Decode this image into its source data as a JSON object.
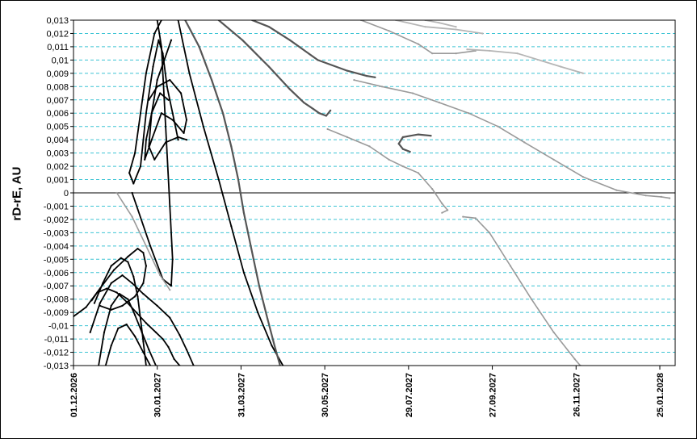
{
  "chart_data": {
    "type": "scatter",
    "title": "",
    "xlabel": "",
    "ylabel": "rD-rE, AU",
    "x_tick_labels": [
      "01.12.2026",
      "30.01.2027",
      "31.03.2027",
      "30.05.2027",
      "29.07.2027",
      "27.09.2027",
      "26.11.2027",
      "25.01.2028"
    ],
    "xlim": [
      "01.12.2026",
      "05.02.2028"
    ],
    "ylim": [
      -0.013,
      0.013
    ],
    "y_tick_labels": [
      "0,013",
      "0,012",
      "0,011",
      "0,01",
      "0,009",
      "0,008",
      "0,007",
      "0,006",
      "0,005",
      "0,004",
      "0,003",
      "0,002",
      "0,001",
      "0",
      "-0,001",
      "-0,002",
      "-0,003",
      "-0,004",
      "-0,005",
      "-0,006",
      "-0,007",
      "-0,008",
      "-0,009",
      "-0,01",
      "-0,011",
      "-0,012",
      "-0,013"
    ],
    "grid": "horizontal dashed",
    "zero_line": true,
    "legend": "none",
    "colors": {
      "grid": "#3cc4d4",
      "dark": "#000000",
      "mid": "#555555",
      "light": "#9a9a9a",
      "lighter": "#b5b5b5"
    },
    "series": [
      {
        "color": "dark",
        "points": [
          [
            "30.01.2027",
            0.013
          ],
          [
            "02.02.2027",
            0.011
          ],
          [
            "05.02.2027",
            0.005
          ],
          [
            "08.02.2027",
            -0.001
          ],
          [
            "10.02.2027",
            -0.005
          ],
          [
            "09.02.2027",
            -0.007
          ],
          [
            "03.02.2027",
            -0.0065
          ],
          [
            "25.01.2027",
            -0.004
          ],
          [
            "12.01.2027",
            0.0
          ]
        ]
      },
      {
        "color": "dark",
        "points": [
          [
            "02.02.2027",
            0.013
          ],
          [
            "28.01.2027",
            0.012
          ],
          [
            "22.01.2027",
            0.009
          ],
          [
            "18.01.2027",
            0.006
          ],
          [
            "14.01.2027",
            0.003
          ],
          [
            "10.01.2027",
            0.0015
          ],
          [
            "13.01.2027",
            0.0007
          ],
          [
            "18.01.2027",
            0.002
          ],
          [
            "22.01.2027",
            0.006
          ],
          [
            "27.01.2027",
            0.0095
          ],
          [
            "31.01.2027",
            0.0115
          ],
          [
            "03.02.2027",
            0.0105
          ],
          [
            "06.02.2027",
            0.008
          ],
          [
            "10.02.2027",
            0.006
          ],
          [
            "14.02.2027",
            0.004
          ]
        ]
      },
      {
        "color": "dark",
        "points": [
          [
            "07.02.2027",
            0.007
          ],
          [
            "01.02.2027",
            0.0075
          ],
          [
            "26.01.2027",
            0.006
          ],
          [
            "22.01.2027",
            0.004
          ],
          [
            "21.01.2027",
            0.0025
          ],
          [
            "26.01.2027",
            0.004
          ],
          [
            "02.02.2027",
            0.006
          ],
          [
            "10.02.2027",
            0.0055
          ],
          [
            "18.02.2027",
            0.0045
          ],
          [
            "20.02.2027",
            0.0055
          ],
          [
            "16.02.2027",
            0.0075
          ],
          [
            "08.02.2027",
            0.0085
          ],
          [
            "30.01.2027",
            0.008
          ],
          [
            "24.01.2027",
            0.007
          ]
        ]
      },
      {
        "color": "dark",
        "points": [
          [
            "09.02.2027",
            0.0115
          ],
          [
            "04.02.2027",
            0.01
          ],
          [
            "30.01.2027",
            0.0085
          ],
          [
            "26.01.2027",
            0.006
          ],
          [
            "24.01.2027",
            0.0035
          ],
          [
            "28.01.2027",
            0.0025
          ],
          [
            "05.02.2027",
            0.0038
          ],
          [
            "14.02.2027",
            0.0042
          ],
          [
            "20.02.2027",
            0.004
          ]
        ]
      },
      {
        "color": "dark",
        "points": [
          [
            "14.02.2027",
            0.013
          ],
          [
            "22.02.2027",
            0.009
          ],
          [
            "04.03.2027",
            0.005
          ],
          [
            "15.03.2027",
            0.001
          ],
          [
            "24.03.2027",
            -0.0025
          ],
          [
            "02.04.2027",
            -0.006
          ],
          [
            "12.04.2027",
            -0.009
          ],
          [
            "22.04.2027",
            -0.0115
          ],
          [
            "30.04.2027",
            -0.013
          ]
        ]
      },
      {
        "color": "dark",
        "points": [
          [
            "01.12.2026",
            -0.0093
          ],
          [
            "10.12.2026",
            -0.0086
          ],
          [
            "20.12.2026",
            -0.0072
          ],
          [
            "30.12.2026",
            -0.0058
          ],
          [
            "09.01.2027",
            -0.0048
          ],
          [
            "16.01.2027",
            -0.0042
          ],
          [
            "20.01.2027",
            -0.0045
          ],
          [
            "22.01.2027",
            -0.0055
          ],
          [
            "20.01.2027",
            -0.0068
          ],
          [
            "14.01.2027",
            -0.0078
          ],
          [
            "05.01.2027",
            -0.0085
          ],
          [
            "28.12.2026",
            -0.0088
          ],
          [
            "20.12.2026",
            -0.0085
          ]
        ]
      },
      {
        "color": "dark",
        "points": [
          [
            "16.12.2026",
            -0.0083
          ],
          [
            "22.12.2026",
            -0.0068
          ],
          [
            "28.12.2026",
            -0.0055
          ],
          [
            "04.01.2027",
            -0.0049
          ],
          [
            "09.01.2027",
            -0.0052
          ],
          [
            "13.01.2027",
            -0.0063
          ],
          [
            "16.01.2027",
            -0.0078
          ],
          [
            "18.01.2027",
            -0.0095
          ],
          [
            "20.01.2027",
            -0.0112
          ],
          [
            "22.01.2027",
            -0.013
          ]
        ]
      },
      {
        "color": "dark",
        "points": [
          [
            "19.12.2026",
            -0.013
          ],
          [
            "23.12.2026",
            -0.0105
          ],
          [
            "28.12.2026",
            -0.0085
          ],
          [
            "03.01.2027",
            -0.0076
          ],
          [
            "09.01.2027",
            -0.008
          ],
          [
            "14.01.2027",
            -0.0092
          ],
          [
            "19.01.2027",
            -0.0105
          ],
          [
            "24.01.2027",
            -0.0118
          ],
          [
            "29.01.2027",
            -0.013
          ]
        ]
      },
      {
        "color": "dark",
        "points": [
          [
            "24.12.2026",
            -0.013
          ],
          [
            "28.12.2026",
            -0.0115
          ],
          [
            "02.01.2027",
            -0.0102
          ],
          [
            "08.01.2027",
            -0.0099
          ],
          [
            "14.01.2027",
            -0.0108
          ],
          [
            "20.01.2027",
            -0.012
          ],
          [
            "25.01.2027",
            -0.013
          ]
        ]
      },
      {
        "color": "dark",
        "points": [
          [
            "14.12.2026",
            -0.0081
          ],
          [
            "18.12.2026",
            -0.0075
          ],
          [
            "25.12.2026",
            -0.0072
          ],
          [
            "01.01.2027",
            -0.0075
          ],
          [
            "08.01.2027",
            -0.0082
          ],
          [
            "15.01.2027",
            -0.009
          ],
          [
            "22.01.2027",
            -0.0098
          ],
          [
            "29.01.2027",
            -0.0105
          ],
          [
            "03.02.2027",
            -0.011
          ],
          [
            "07.02.2027",
            -0.0116
          ],
          [
            "11.02.2027",
            -0.0125
          ],
          [
            "15.02.2027",
            -0.013
          ]
        ]
      },
      {
        "color": "dark",
        "points": [
          [
            "13.12.2026",
            -0.0105
          ],
          [
            "20.12.2026",
            -0.0083
          ],
          [
            "28.12.2026",
            -0.0068
          ],
          [
            "05.01.2027",
            -0.0062
          ],
          [
            "12.01.2027",
            -0.0068
          ],
          [
            "20.01.2027",
            -0.0076
          ],
          [
            "30.01.2027",
            -0.0085
          ],
          [
            "08.02.2027",
            -0.0094
          ],
          [
            "15.02.2027",
            -0.0107
          ],
          [
            "20.02.2027",
            -0.0118
          ],
          [
            "25.02.2027",
            -0.013
          ]
        ]
      },
      {
        "color": "mid",
        "points": [
          [
            "19.02.2027",
            0.013
          ],
          [
            "01.03.2027",
            0.011
          ],
          [
            "10.03.2027",
            0.0085
          ],
          [
            "18.03.2027",
            0.006
          ],
          [
            "24.03.2027",
            0.0035
          ],
          [
            "29.03.2027",
            0.001
          ],
          [
            "02.04.2027",
            -0.0015
          ],
          [
            "07.04.2027",
            -0.004
          ],
          [
            "13.04.2027",
            -0.007
          ],
          [
            "19.04.2027",
            -0.0095
          ],
          [
            "24.04.2027",
            -0.0115
          ],
          [
            "28.04.2027",
            -0.013
          ]
        ]
      },
      {
        "color": "mid",
        "points": [
          [
            "15.03.2027",
            0.013
          ],
          [
            "01.04.2027",
            0.0115
          ],
          [
            "20.04.2027",
            0.0095
          ],
          [
            "05.05.2027",
            0.0078
          ],
          [
            "15.05.2027",
            0.0068
          ],
          [
            "22.05.2027",
            0.0063
          ],
          [
            "26.05.2027",
            0.006
          ],
          [
            "31.05.2027",
            0.0058
          ],
          [
            "03.06.2027",
            0.0062
          ]
        ]
      },
      {
        "color": "mid",
        "points": [
          [
            "08.04.2027",
            0.013
          ],
          [
            "20.04.2027",
            0.0125
          ],
          [
            "05.05.2027",
            0.0115
          ],
          [
            "25.05.2027",
            0.01
          ],
          [
            "15.06.2027",
            0.0092
          ],
          [
            "29.06.2027",
            0.0088
          ],
          [
            "05.07.2027",
            0.0087
          ]
        ]
      },
      {
        "color": "mid",
        "points": [
          [
            "14.08.2027",
            0.0043
          ],
          [
            "05.08.2027",
            0.0044
          ],
          [
            "25.07.2027",
            0.0042
          ],
          [
            "22.07.2027",
            0.0037
          ],
          [
            "25.07.2027",
            0.0033
          ],
          [
            "30.07.2027",
            0.0031
          ]
        ]
      },
      {
        "color": "light",
        "points": [
          [
            "25.06.2027",
            0.013
          ],
          [
            "15.07.2027",
            0.0122
          ],
          [
            "05.08.2027",
            0.0112
          ],
          [
            "15.08.2027",
            0.0105
          ],
          [
            "01.09.2027",
            0.0105
          ],
          [
            "15.09.2027",
            0.0107
          ]
        ]
      },
      {
        "color": "light",
        "points": [
          [
            "20.06.2027",
            0.0085
          ],
          [
            "10.07.2027",
            0.008
          ],
          [
            "01.08.2027",
            0.0075
          ],
          [
            "20.08.2027",
            0.0068
          ],
          [
            "10.09.2027",
            0.006
          ],
          [
            "01.10.2027",
            0.005
          ],
          [
            "20.10.2027",
            0.0038
          ],
          [
            "10.11.2027",
            0.0025
          ],
          [
            "01.12.2027",
            0.0012
          ],
          [
            "25.12.2027",
            0.0002
          ],
          [
            "15.01.2028",
            -0.0002
          ],
          [
            "26.01.2028",
            -0.0003
          ],
          [
            "01.02.2028",
            -0.0004
          ]
        ]
      },
      {
        "color": "light",
        "points": [
          [
            "01.01.2027",
            0.0
          ],
          [
            "12.01.2027",
            -0.0018
          ],
          [
            "22.01.2027",
            -0.004
          ],
          [
            "01.02.2027",
            -0.0062
          ],
          [
            "08.02.2027",
            -0.0073
          ]
        ]
      },
      {
        "color": "light",
        "points": [
          [
            "01.06.2027",
            0.0048
          ],
          [
            "15.06.2027",
            0.0042
          ],
          [
            "01.07.2027",
            0.0035
          ],
          [
            "15.07.2027",
            0.0025
          ],
          [
            "25.07.2027",
            0.002
          ],
          [
            "05.08.2027",
            0.0015
          ],
          [
            "15.08.2027",
            0.0003
          ],
          [
            "22.08.2027",
            -0.0008
          ],
          [
            "26.08.2027",
            -0.0013
          ],
          [
            "22.08.2027",
            -0.0015
          ]
        ]
      },
      {
        "color": "light",
        "points": [
          [
            "06.09.2027",
            -0.0018
          ],
          [
            "15.09.2027",
            -0.0019
          ],
          [
            "25.09.2027",
            -0.003
          ],
          [
            "10.10.2027",
            -0.0055
          ],
          [
            "25.10.2027",
            -0.008
          ],
          [
            "10.11.2027",
            -0.0105
          ],
          [
            "25.11.2027",
            -0.0125
          ],
          [
            "29.11.2027",
            -0.013
          ]
        ]
      },
      {
        "color": "lighter",
        "points": [
          [
            "20.07.2027",
            0.013
          ],
          [
            "10.08.2027",
            0.0125
          ],
          [
            "01.09.2027",
            0.0123
          ],
          [
            "20.09.2027",
            0.012
          ]
        ]
      },
      {
        "color": "lighter",
        "points": [
          [
            "09.09.2027",
            0.0108
          ],
          [
            "25.09.2027",
            0.0107
          ],
          [
            "15.10.2027",
            0.0105
          ],
          [
            "15.11.2027",
            0.0095
          ],
          [
            "01.12.2027",
            0.009
          ]
        ]
      },
      {
        "color": "lighter",
        "points": [
          [
            "10.08.2027",
            0.013
          ],
          [
            "20.08.2027",
            0.0128
          ],
          [
            "01.09.2027",
            0.0125
          ]
        ]
      }
    ]
  }
}
